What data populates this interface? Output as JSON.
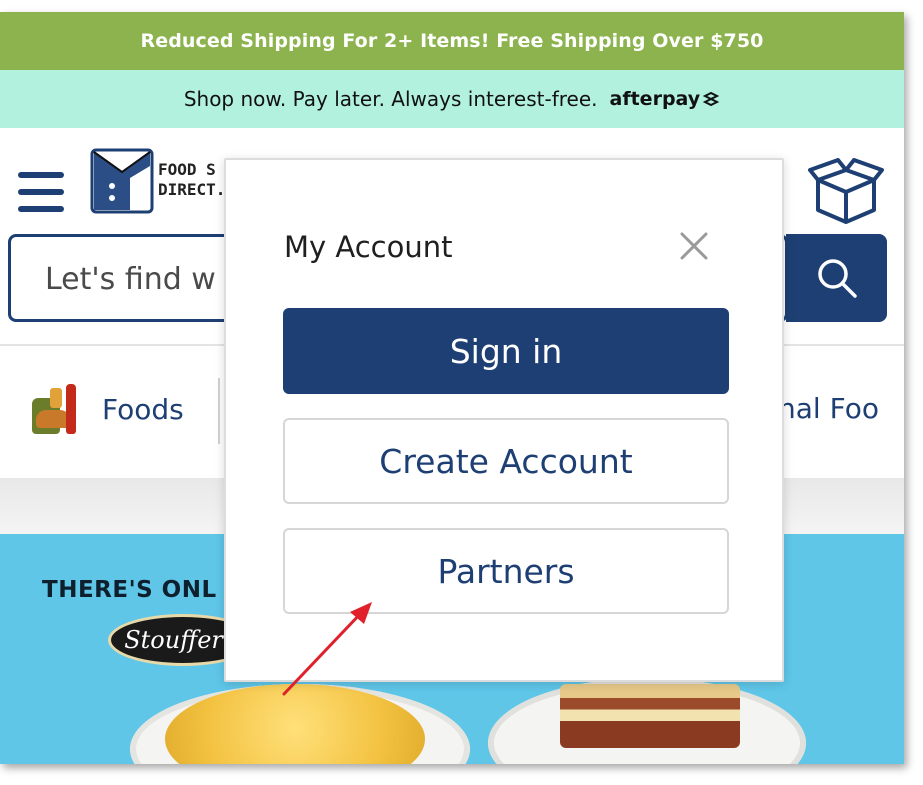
{
  "promo": {
    "text": "Reduced Shipping For 2+ Items! Free Shipping Over $750"
  },
  "afterpay": {
    "text": "Shop now. Pay later. Always interest-free.",
    "logo": "afterpay"
  },
  "header": {
    "logo_line1": "FOOD S",
    "logo_line2": "DIRECT."
  },
  "search": {
    "placeholder": "Let's find w"
  },
  "categories": {
    "left_label": "Foods",
    "right_label": "nal Foo"
  },
  "hero": {
    "headline": "THERE'S ONL",
    "brand": "Stouffer's"
  },
  "modal": {
    "title": "My Account",
    "sign_in": "Sign in",
    "create_account": "Create Account",
    "partners": "Partners"
  },
  "colors": {
    "navy": "#1e3f73",
    "promo_green": "#8cb34d",
    "afterpay_mint": "#b2f1de",
    "hero_blue": "#5fc6e8",
    "annotation_red": "#e0202a"
  },
  "icons": [
    "menu-icon",
    "box-icon",
    "search-icon",
    "close-icon",
    "afterpay-arrows-icon"
  ]
}
